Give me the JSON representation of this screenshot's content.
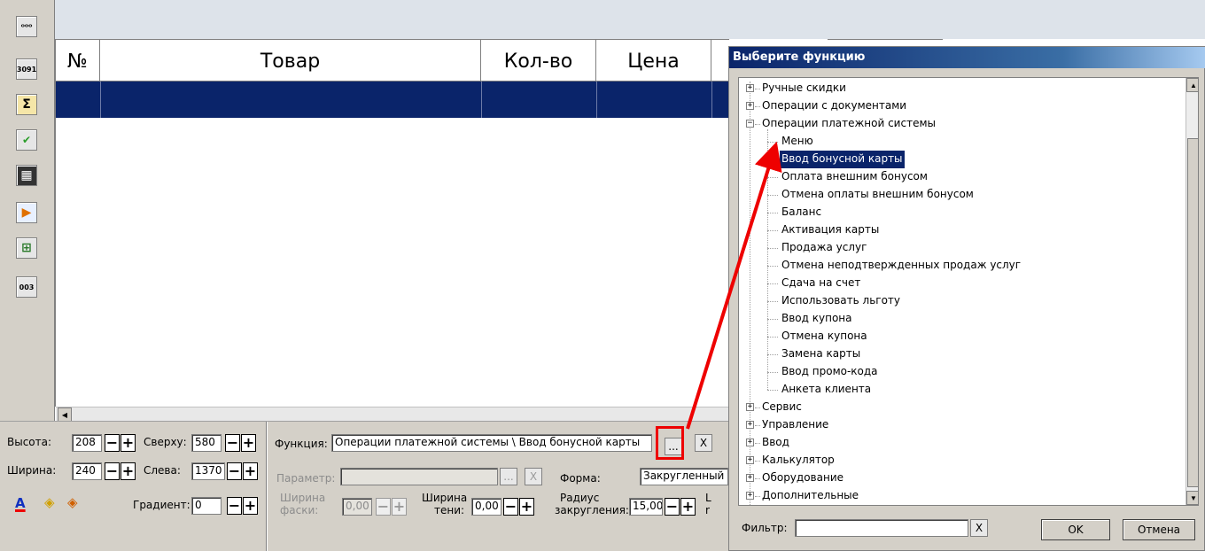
{
  "toolbar": {
    "buttons": [
      "barcode-icon",
      "info-icon",
      "sum-icon",
      "check-icon",
      "film-icon",
      "play-icon",
      "tree-icon",
      "numeric-icon"
    ],
    "labels": {
      "barcode": "ᴼᴼᴼ",
      "info": "3091",
      "sum": "Σ",
      "check": "✔",
      "film": "▦",
      "play": "▶",
      "tree": "⊞",
      "numeric": "003"
    }
  },
  "table": {
    "columns": [
      "№",
      "Товар",
      "Кол-во",
      "Цена"
    ]
  },
  "panel": {
    "height_label": "Высота:",
    "height_value": "208",
    "top_label": "Сверху:",
    "top_value": "580",
    "width_label": "Ширина:",
    "width_value": "240",
    "left_label": "Слева:",
    "left_value": "1370",
    "gradient_label": "Градиент:",
    "gradient_value": "0",
    "function_label": "Функция:",
    "function_value": "Операции платежной системы \\ Ввод бонусной карты",
    "browse_label": "...",
    "clear_label": "X",
    "param_label": "Параметр:",
    "param_browse": "...",
    "param_clear": "X",
    "form_label": "Форма:",
    "form_value": "Закругленный",
    "bevel_label_1": "Ширина",
    "bevel_label_2": "фаски:",
    "bevel_value": "0,00",
    "shadow_label_1": "Ширина",
    "shadow_label_2": "тени:",
    "shadow_value": "0,00",
    "radius_label_1": "Радиус",
    "radius_label_2": "закругления:",
    "radius_value": "15,00",
    "cut_label_1": "L",
    "cut_label_2": "r",
    "minus": "−",
    "plus": "+"
  },
  "dialog": {
    "title": "Выберите функцию",
    "tree": [
      {
        "label": "Ручные скидки",
        "level": 0,
        "expander": "+"
      },
      {
        "label": "Операции с документами",
        "level": 0,
        "expander": "+"
      },
      {
        "label": "Операции платежной системы",
        "level": 0,
        "expander": "−"
      },
      {
        "label": "Меню",
        "level": 1
      },
      {
        "label": "Ввод бонусной карты",
        "level": 1,
        "selected": true
      },
      {
        "label": "Оплата внешним бонусом",
        "level": 1
      },
      {
        "label": "Отмена оплаты внешним бонусом",
        "level": 1
      },
      {
        "label": "Баланс",
        "level": 1
      },
      {
        "label": "Активация карты",
        "level": 1
      },
      {
        "label": "Продажа услуг",
        "level": 1
      },
      {
        "label": "Отмена неподтвержденных продаж услуг",
        "level": 1
      },
      {
        "label": "Сдача на счет",
        "level": 1
      },
      {
        "label": "Использовать льготу",
        "level": 1
      },
      {
        "label": "Ввод купона",
        "level": 1
      },
      {
        "label": "Отмена купона",
        "level": 1
      },
      {
        "label": "Замена карты",
        "level": 1
      },
      {
        "label": "Ввод промо-кода",
        "level": 1
      },
      {
        "label": "Анкета клиента",
        "level": 1
      },
      {
        "label": "Сервис",
        "level": 0,
        "expander": "+"
      },
      {
        "label": "Управление",
        "level": 0,
        "expander": "+"
      },
      {
        "label": "Ввод",
        "level": 0,
        "expander": "+"
      },
      {
        "label": "Калькулятор",
        "level": 0,
        "expander": "+"
      },
      {
        "label": "Оборудование",
        "level": 0,
        "expander": "+"
      },
      {
        "label": "Дополнительные",
        "level": 0,
        "expander": "+"
      }
    ],
    "filter_label": "Фильтр:",
    "filter_value": "",
    "filter_clear": "X",
    "ok_label": "OK",
    "cancel_label": "Отмена"
  },
  "colors": {
    "selection": "#0a246a",
    "annotation": "#e00000",
    "panel_bg": "#d4d0c8"
  }
}
